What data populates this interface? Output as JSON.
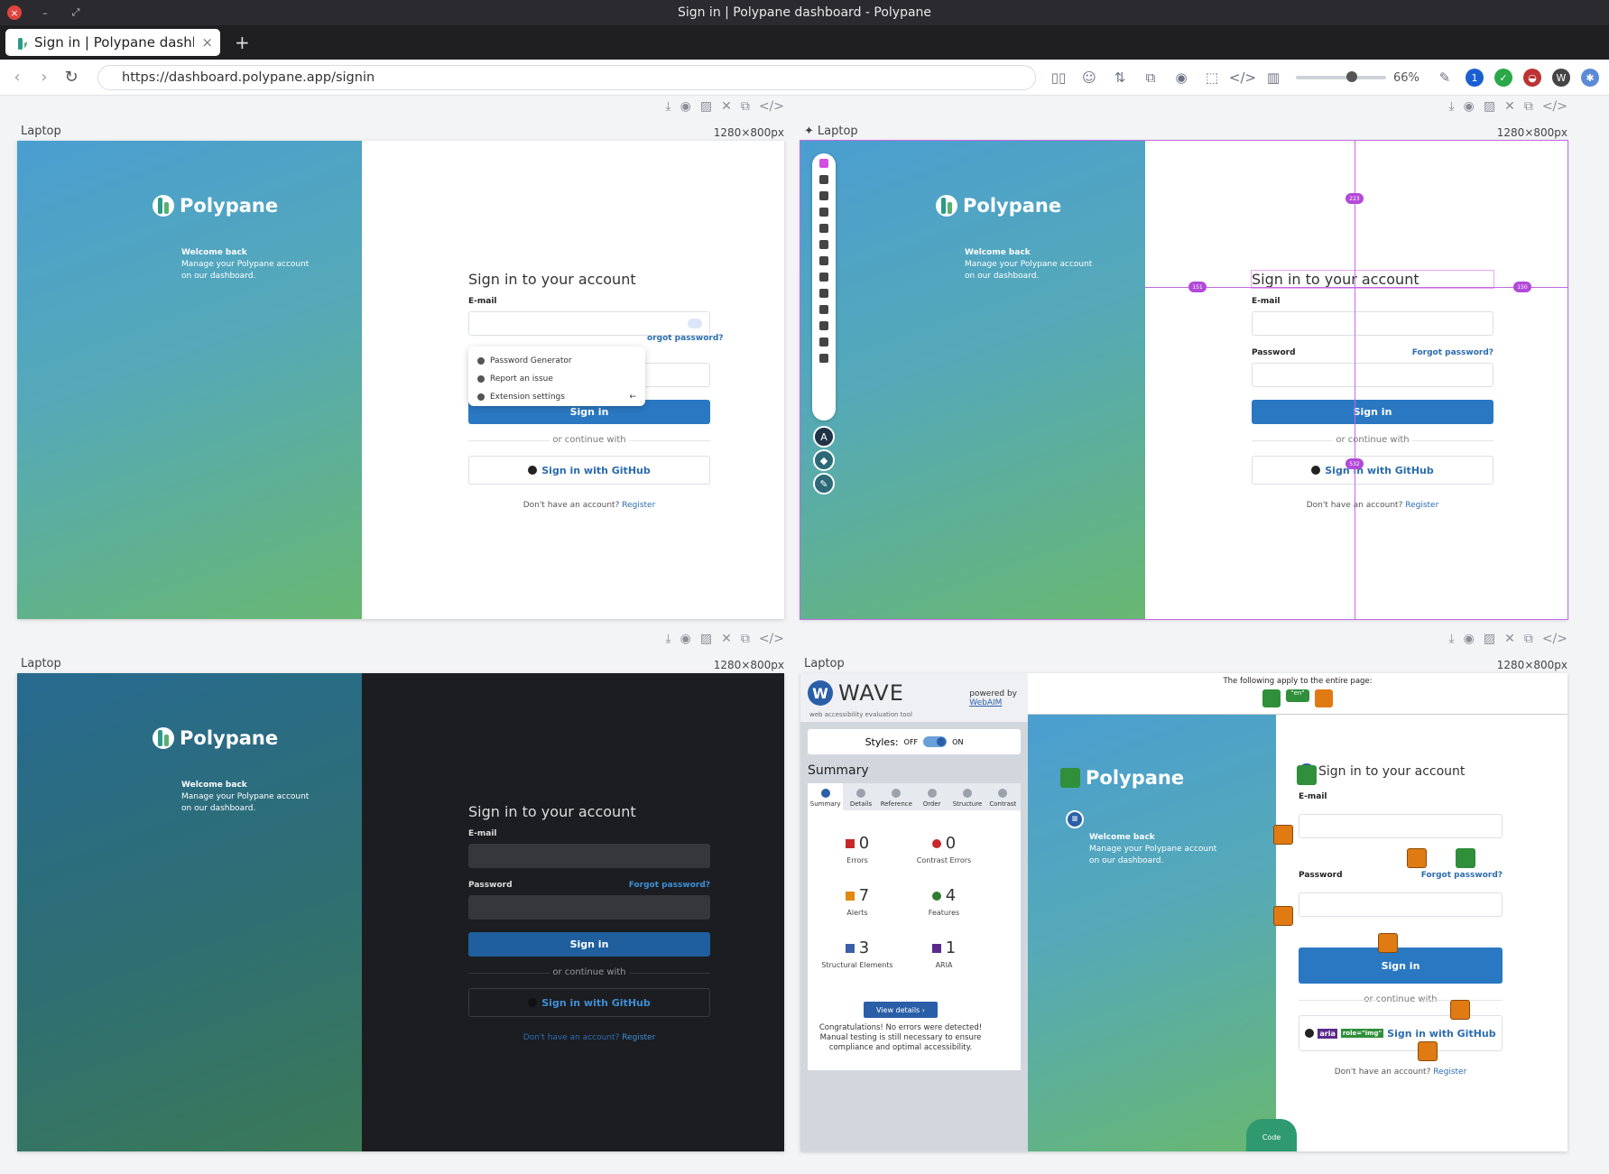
{
  "window": {
    "title": "Sign in | Polypane dashboard - Polypane"
  },
  "tab": {
    "title": "Sign in | Polypane dashboard",
    "close": "×",
    "new": "+"
  },
  "nav": {
    "url": "https://dashboard.polypane.app/signin",
    "zoom": "66%"
  },
  "panes": [
    {
      "label": "Laptop",
      "size": "1280×800px",
      "mode": "light"
    },
    {
      "label": "Laptop",
      "size": "1280×800px",
      "mode": "ruler"
    },
    {
      "label": "Laptop",
      "size": "1280×800px",
      "mode": "dark"
    },
    {
      "label": "Laptop",
      "size": "1280×800px",
      "mode": "wave"
    }
  ],
  "site": {
    "brand": "Polypane",
    "welcome_title": "Welcome back",
    "welcome_text": "Manage your Polypane account on our dashboard.",
    "heading": "Sign in to your account",
    "email_label": "E-mail",
    "password_label": "Password",
    "forgot": "Forgot password?",
    "signin": "Sign in",
    "or": "or continue with",
    "github": "Sign in with GitHub",
    "no_account": "Don't have an account?",
    "register": "Register"
  },
  "popup": {
    "items": [
      "Password Generator",
      "Report an issue",
      "Extension settings"
    ],
    "partial_forgot": "orgot password?"
  },
  "ruler": {
    "top": "223",
    "left": "151",
    "right": "150",
    "bottom": "532"
  },
  "wave": {
    "title": "WAVE",
    "subtitle": "web accessibility evaluation tool",
    "powered": "powered by",
    "webaim": "WebAIM",
    "styles_label": "Styles:",
    "off": "OFF",
    "on": "ON",
    "summary": "Summary",
    "tabs": [
      "Summary",
      "Details",
      "Reference",
      "Order",
      "Structure",
      "Contrast"
    ],
    "stats": [
      {
        "n": "0",
        "label": "Errors"
      },
      {
        "n": "0",
        "label": "Contrast Errors"
      },
      {
        "n": "7",
        "label": "Alerts"
      },
      {
        "n": "4",
        "label": "Features"
      },
      {
        "n": "3",
        "label": "Structural Elements"
      },
      {
        "n": "1",
        "label": "ARIA"
      }
    ],
    "view_details": "View details ›",
    "congrats": "Congratulations! No errors were detected! Manual testing is still necessary to ensure compliance and optimal accessibility.",
    "page_note": "The following apply to the entire page:",
    "lang": "\"en\"",
    "role_img": "role=\"img\"",
    "aria": "aria",
    "h2": "h2",
    "code": "Code"
  },
  "colors": {
    "primary": "#2a78c2",
    "link": "#2b6cb0",
    "ruler": "#c26ae0",
    "wave_alert": "#e07a12"
  }
}
